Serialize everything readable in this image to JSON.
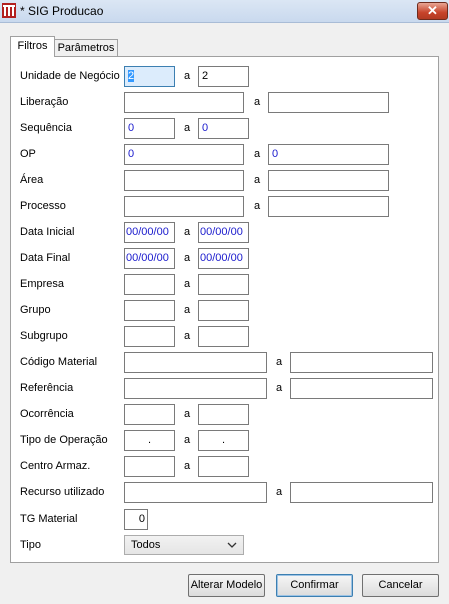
{
  "window": {
    "title": "* SIG Producao",
    "close_glyph": "✕"
  },
  "tabs": [
    {
      "label": "Filtros",
      "active": true
    },
    {
      "label": "Parâmetros",
      "active": false
    }
  ],
  "separator": "a",
  "fields": {
    "unidade": {
      "label": "Unidade de Negócio",
      "from": "2",
      "to": "2"
    },
    "liberacao": {
      "label": "Liberação",
      "from": "",
      "to": ""
    },
    "sequencia": {
      "label": "Sequência",
      "from": "0",
      "to": "0"
    },
    "op": {
      "label": "OP",
      "from": "0",
      "to": "0"
    },
    "area": {
      "label": "Área",
      "from": "",
      "to": ""
    },
    "processo": {
      "label": "Processo",
      "from": "",
      "to": ""
    },
    "data_inicial": {
      "label": "Data Inicial",
      "from": "00/00/00",
      "to": "00/00/00"
    },
    "data_final": {
      "label": "Data Final",
      "from": "00/00/00",
      "to": "00/00/00"
    },
    "empresa": {
      "label": "Empresa",
      "from": "",
      "to": ""
    },
    "grupo": {
      "label": "Grupo",
      "from": "",
      "to": ""
    },
    "subgrupo": {
      "label": "Subgrupo",
      "from": "",
      "to": ""
    },
    "codigo_material": {
      "label": "Código Material",
      "from": "",
      "to": ""
    },
    "referencia": {
      "label": "Referência",
      "from": "",
      "to": ""
    },
    "ocorrencia": {
      "label": "Ocorrência",
      "from": "",
      "to": ""
    },
    "tipo_operacao": {
      "label": "Tipo de Operação",
      "from": ".",
      "to": "."
    },
    "centro_armaz": {
      "label": "Centro Armaz.",
      "from": "",
      "to": ""
    },
    "recurso": {
      "label": "Recurso utilizado",
      "from": "",
      "to": ""
    },
    "tg_material": {
      "label": "TG Material",
      "value": "0"
    },
    "tipo": {
      "label": "Tipo",
      "selected": "Todos"
    }
  },
  "buttons": {
    "alterar": "Alterar Modelo",
    "confirmar": "Confirmar",
    "cancelar": "Cancelar"
  },
  "icons": {
    "app": "app-logo-icon",
    "close": "close-icon",
    "chevron": "chevron-down-icon"
  },
  "colors": {
    "title_bar": "#c9d9ee",
    "close_button": "#c7432a",
    "field_text": "#1a1acd",
    "highlight": "#dcecfc"
  }
}
